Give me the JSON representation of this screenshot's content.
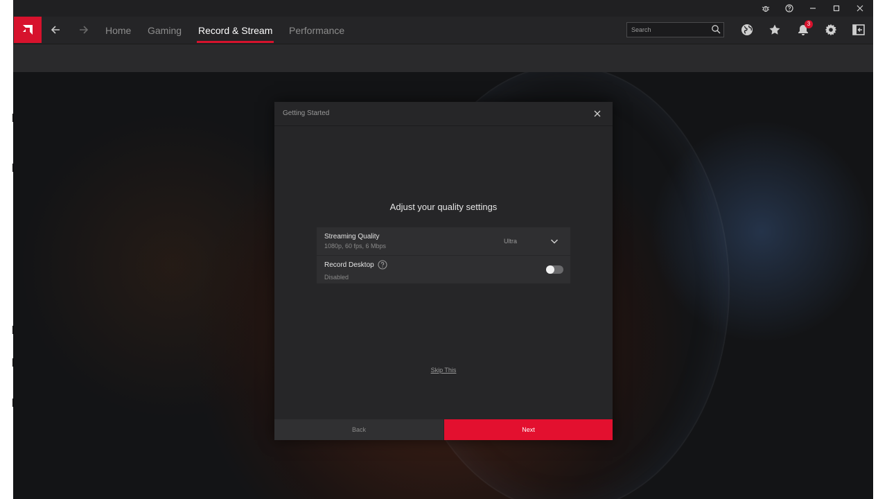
{
  "nav": {
    "tabs": [
      "Home",
      "Gaming",
      "Record & Stream",
      "Performance"
    ],
    "active_tab": "Record & Stream",
    "search_placeholder": "Search",
    "notification_count": "3"
  },
  "dialog": {
    "title": "Getting Started",
    "heading": "Adjust your quality settings",
    "streaming_quality": {
      "label": "Streaming Quality",
      "description": "1080p, 60 fps, 6 Mbps",
      "value": "Ultra"
    },
    "record_desktop": {
      "label": "Record Desktop",
      "status": "Disabled",
      "enabled": false
    },
    "skip_label": "Skip This",
    "back_label": "Back",
    "next_label": "Next"
  },
  "colors": {
    "accent": "#e3102f",
    "background": "#121214",
    "panel": "#262628"
  },
  "icons": {
    "logo": "amd-logo-icon",
    "back": "arrow-left-icon",
    "forward": "arrow-right-icon",
    "search": "search-icon",
    "globe": "globe-icon",
    "favorites": "star-icon",
    "notifications": "bell-icon",
    "settings": "gear-icon",
    "panel": "panel-toggle-icon"
  }
}
